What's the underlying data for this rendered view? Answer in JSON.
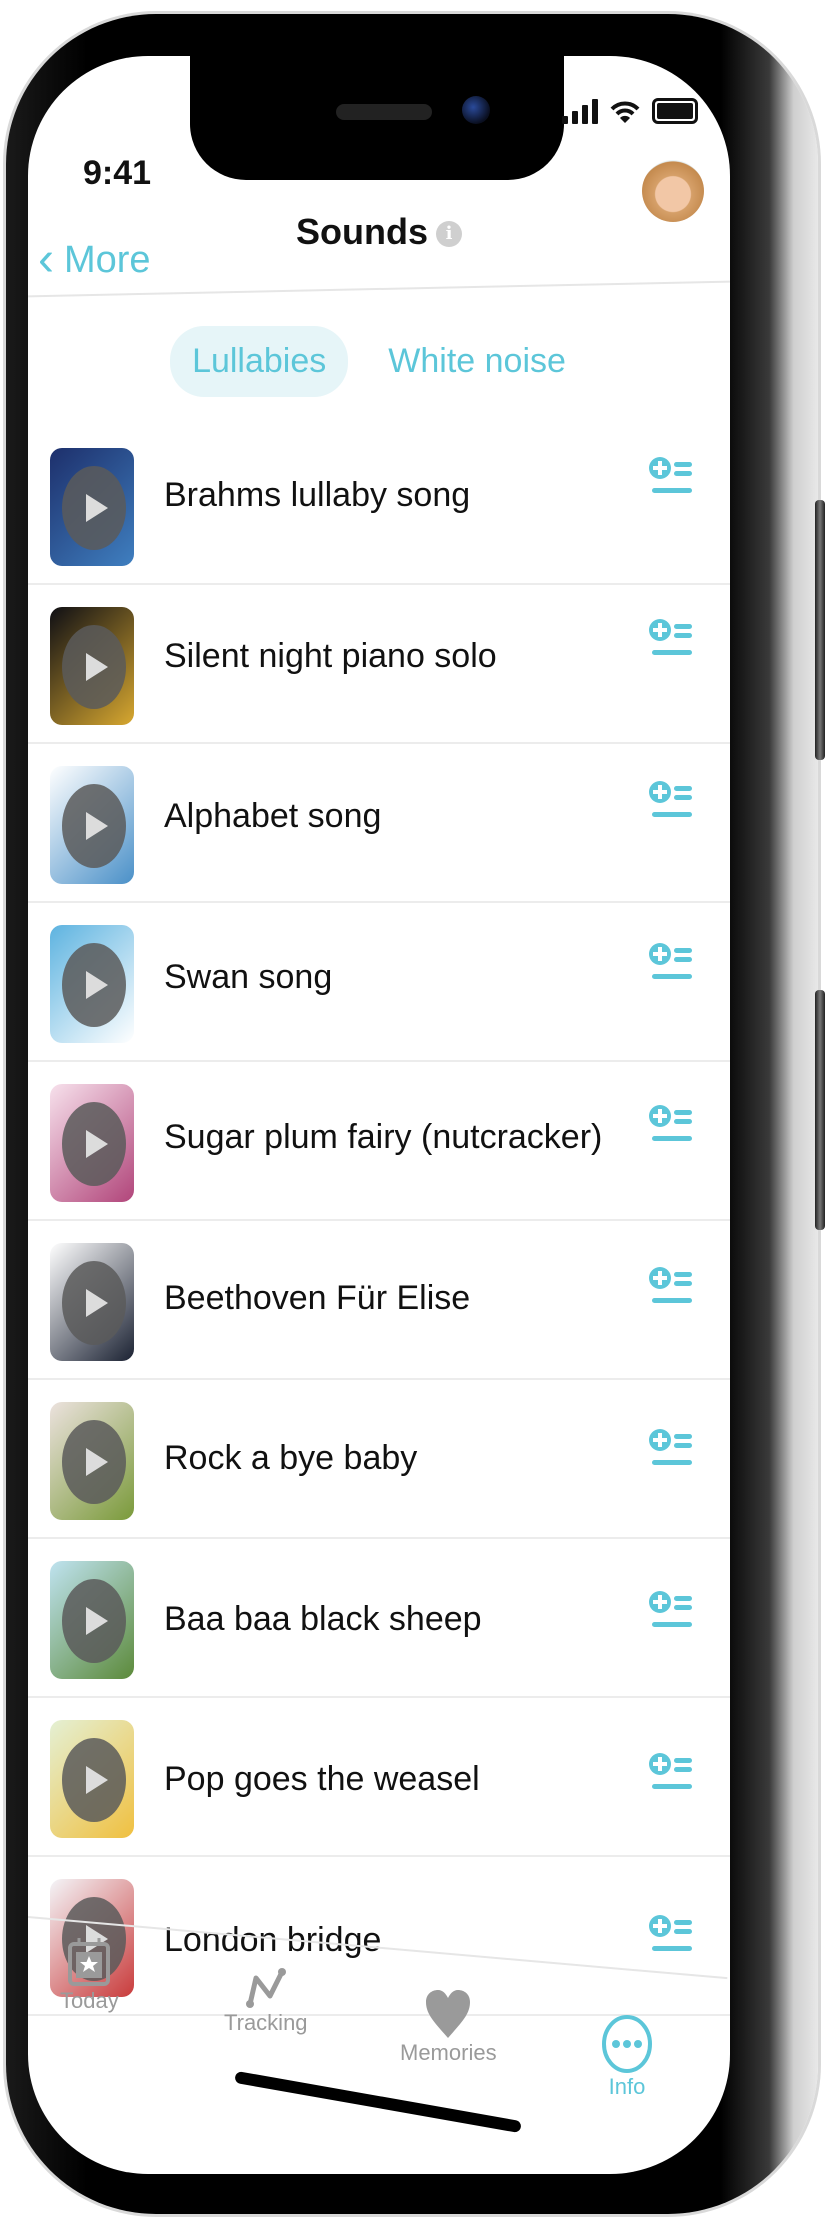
{
  "status_bar": {
    "time": "9:41"
  },
  "nav": {
    "back_label": "More",
    "title": "Sounds",
    "info_glyph": "i"
  },
  "tabs": [
    {
      "label": "Lullabies",
      "active": true
    },
    {
      "label": "White noise",
      "active": false
    }
  ],
  "sounds": [
    {
      "title": "Brahms lullaby song",
      "thumb_colors": [
        "#1d2f6b",
        "#3f7fc0"
      ]
    },
    {
      "title": "Silent night piano solo",
      "thumb_colors": [
        "#0e0e14",
        "#d8a830"
      ]
    },
    {
      "title": "Alphabet song",
      "thumb_colors": [
        "#ffffff",
        "#4a90c8"
      ]
    },
    {
      "title": "Swan song",
      "thumb_colors": [
        "#5db3e0",
        "#ffffff"
      ]
    },
    {
      "title": "Sugar plum fairy (nutcracker)",
      "thumb_colors": [
        "#f7e1ec",
        "#b1457a"
      ]
    },
    {
      "title": "Beethoven Für Elise",
      "thumb_colors": [
        "#ffffff",
        "#1b2233"
      ]
    },
    {
      "title": "Rock a bye baby",
      "thumb_colors": [
        "#ece2de",
        "#7a9a3a"
      ]
    },
    {
      "title": "Baa baa black sheep",
      "thumb_colors": [
        "#bfe3f0",
        "#5c8a3a"
      ]
    },
    {
      "title": "Pop goes the weasel",
      "thumb_colors": [
        "#e4f0d4",
        "#f0c040"
      ]
    },
    {
      "title": "London bridge",
      "thumb_colors": [
        "#f4f5f8",
        "#c93b3b"
      ]
    }
  ],
  "tab_bar": [
    {
      "label": "Today",
      "icon": "calendar-star-icon",
      "active": false
    },
    {
      "label": "Tracking",
      "icon": "line-chart-icon",
      "active": false
    },
    {
      "label": "Memories",
      "icon": "heart-icon",
      "active": false
    },
    {
      "label": "Info",
      "icon": "more-circle-icon",
      "active": true
    }
  ],
  "colors": {
    "accent": "#5cc6d9",
    "inactive": "#9a9a9a",
    "text": "#111111"
  }
}
